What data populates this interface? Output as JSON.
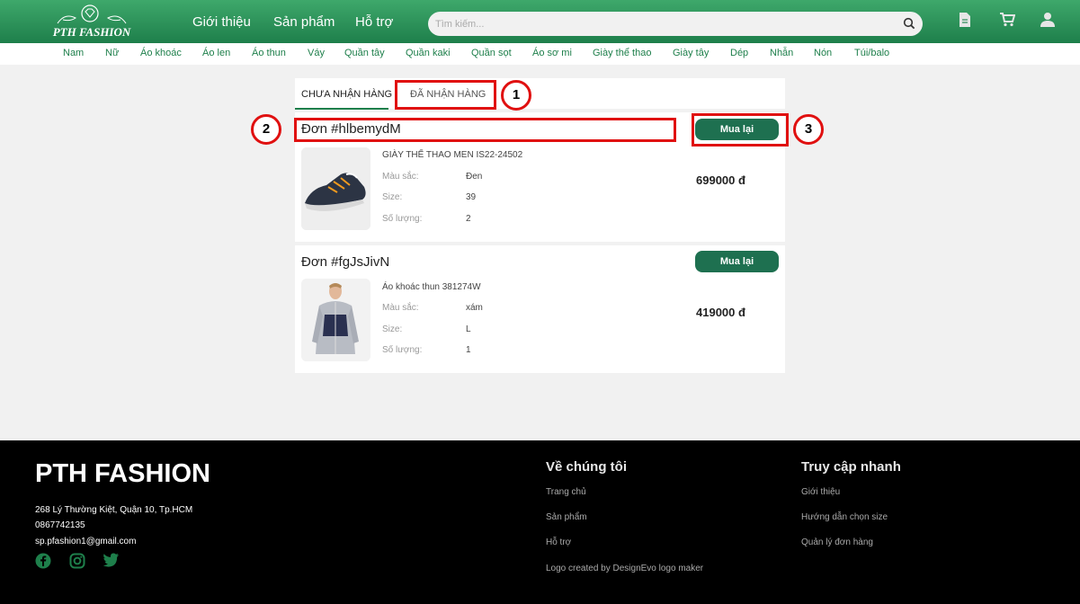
{
  "header": {
    "logo_text": "PTH FASHION",
    "nav": [
      "Giới thiệu",
      "Sản phẩm",
      "Hỗ trợ"
    ],
    "search_placeholder": "Tìm kiếm...",
    "icons": [
      "search-icon",
      "document-icon",
      "cart-icon",
      "user-icon"
    ]
  },
  "categories": [
    "Nam",
    "Nữ",
    "Áo khoác",
    "Áo len",
    "Áo thun",
    "Váy",
    "Quần tây",
    "Quần kaki",
    "Quần sọt",
    "Áo sơ mi",
    "Giày thể thao",
    "Giày tây",
    "Dép",
    "Nhẫn",
    "Nón",
    "Túi/balo"
  ],
  "tabs": {
    "active": "Chưa nhận hàng",
    "inactive": "Đã nhận hàng"
  },
  "labels": {
    "color": "Màu sắc:",
    "size": "Size:",
    "quantity": "Số lượng:",
    "buy_again": "Mua lại"
  },
  "orders": [
    {
      "title": "Đơn #hlbemydM",
      "product": "Giày thể thao Men IS22-24502",
      "color": "Đen",
      "size": "39",
      "quantity": "2",
      "price": "699000 đ"
    },
    {
      "title": "Đơn #fgJsJivN",
      "product": "Áo khoác thun 381274W",
      "color": "xám",
      "size": "L",
      "quantity": "1",
      "price": "419000 đ"
    }
  ],
  "annotations": [
    "1",
    "2",
    "3"
  ],
  "footer": {
    "brand": "PTH FASHION",
    "address": "268 Lý Thường Kiệt, Quận 10, Tp.HCM",
    "phone": "0867742135",
    "email": "sp.pfashion1@gmail.com",
    "social_icons": [
      "facebook-icon",
      "instagram-icon",
      "twitter-icon"
    ],
    "about": {
      "heading": "Về chúng tôi",
      "links": [
        "Trang chủ",
        "Sản phẩm",
        "Hỗ trợ",
        "Logo created by DesignEvo logo maker"
      ]
    },
    "quick": {
      "heading": "Truy cập nhanh",
      "links": [
        "Giới thiệu",
        "Hướng dẫn chọn size",
        "Quản lý đơn hàng"
      ]
    }
  },
  "colors": {
    "brand_green": "#1e7f4b",
    "button_green": "#1e7050",
    "annotation_red": "#e01010"
  }
}
